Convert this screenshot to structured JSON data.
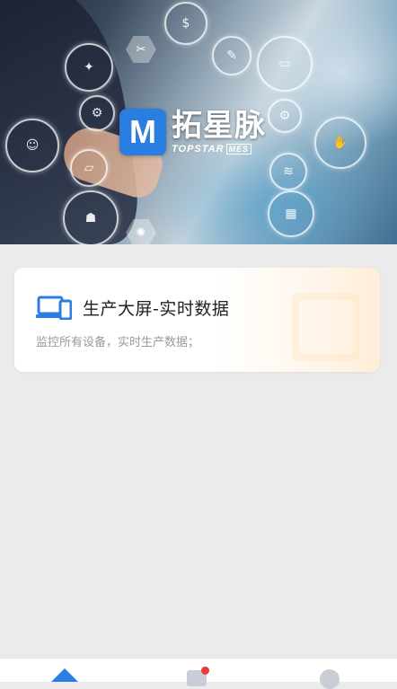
{
  "banner": {
    "logo_mark": "M",
    "brand_cn": "拓星脉",
    "brand_en": "TOPSTAR",
    "brand_badge": "MES",
    "ring_icons": [
      "dollar-icon",
      "bulb-icon",
      "robot-arm-icon",
      "wrench-icon",
      "truck-icon",
      "gear-icon",
      "handshake-icon",
      "wifi-icon",
      "factory-icon",
      "atom-icon",
      "person-icon"
    ]
  },
  "card": {
    "icon": "device-monitor-icon",
    "title": "生产大屏-实时数据",
    "description": "监控所有设备，实时生产数据；",
    "accent_color": "#2a7de1"
  },
  "tabbar": {
    "tabs": [
      {
        "icon": "home-icon",
        "active": true
      },
      {
        "icon": "message-icon",
        "badge": true,
        "badge_color": "#e83a3a"
      },
      {
        "icon": "user-icon"
      }
    ]
  }
}
